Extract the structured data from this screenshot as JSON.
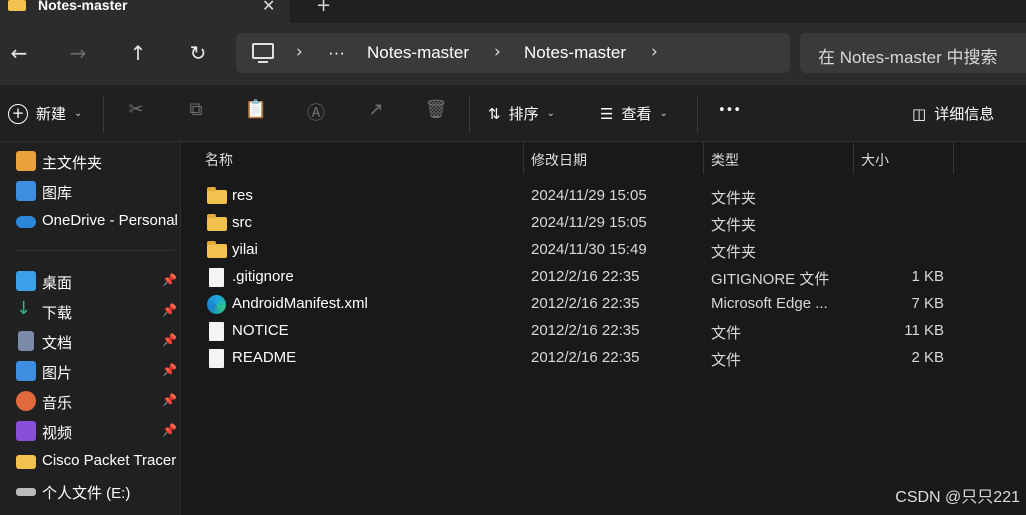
{
  "tab": {
    "title": "Notes-master",
    "close": "✕",
    "new": "+"
  },
  "nav": {
    "back": "←",
    "forward": "→",
    "up": "↑",
    "refresh": "↻"
  },
  "address": {
    "more": "···",
    "crumbs": [
      "Notes-master",
      "Notes-master"
    ],
    "chevron": "›"
  },
  "search": {
    "placeholder": "在 Notes-master 中搜索"
  },
  "toolbar": {
    "new_label": "新建",
    "sort_label": "排序",
    "view_label": "查看",
    "more_label": "•••",
    "details_label": "详细信息"
  },
  "sidebar": {
    "items": [
      {
        "label": "主文件夹",
        "icon": "home-icon",
        "color": "#e9a13b"
      },
      {
        "label": "图库",
        "icon": "gallery-icon",
        "color": "#3d8ee0"
      },
      {
        "label": "OneDrive - Personal",
        "icon": "onedrive-icon",
        "color": "#2b88d8"
      }
    ],
    "pinned": [
      {
        "label": "桌面",
        "icon": "desktop-icon",
        "color": "#3aa0e8"
      },
      {
        "label": "下载",
        "icon": "download-icon",
        "color": "#2fb38e"
      },
      {
        "label": "文档",
        "icon": "documents-icon",
        "color": "#7a8aa8"
      },
      {
        "label": "图片",
        "icon": "pictures-icon",
        "color": "#3d8ee0"
      },
      {
        "label": "音乐",
        "icon": "music-icon",
        "color": "#e06a3d"
      },
      {
        "label": "视频",
        "icon": "videos-icon",
        "color": "#8a4fd8"
      }
    ],
    "folder": {
      "label": "Cisco Packet Tracer",
      "icon": "folder-icon",
      "color": "#f2c14e"
    },
    "drive": {
      "label": "个人文件 (E:)",
      "icon": "drive-icon",
      "color": "#bbbbbb"
    }
  },
  "columns": {
    "name": "名称",
    "modified": "修改日期",
    "type": "类型",
    "size": "大小"
  },
  "files": [
    {
      "name": "res",
      "modified": "2024/11/29 15:05",
      "type": "文件夹",
      "size": "",
      "icon": "folder-icon"
    },
    {
      "name": "src",
      "modified": "2024/11/29 15:05",
      "type": "文件夹",
      "size": "",
      "icon": "folder-icon"
    },
    {
      "name": "yilai",
      "modified": "2024/11/30 15:49",
      "type": "文件夹",
      "size": "",
      "icon": "folder-icon"
    },
    {
      "name": ".gitignore",
      "modified": "2012/2/16 22:35",
      "type": "GITIGNORE 文件",
      "size": "1 KB",
      "icon": "file-icon"
    },
    {
      "name": "AndroidManifest.xml",
      "modified": "2012/2/16 22:35",
      "type": "Microsoft Edge ...",
      "size": "7 KB",
      "icon": "edge-icon"
    },
    {
      "name": "NOTICE",
      "modified": "2012/2/16 22:35",
      "type": "文件",
      "size": "11 KB",
      "icon": "file-icon"
    },
    {
      "name": "README",
      "modified": "2012/2/16 22:35",
      "type": "文件",
      "size": "2 KB",
      "icon": "file-icon"
    }
  ],
  "watermark": "CSDN @只只221"
}
